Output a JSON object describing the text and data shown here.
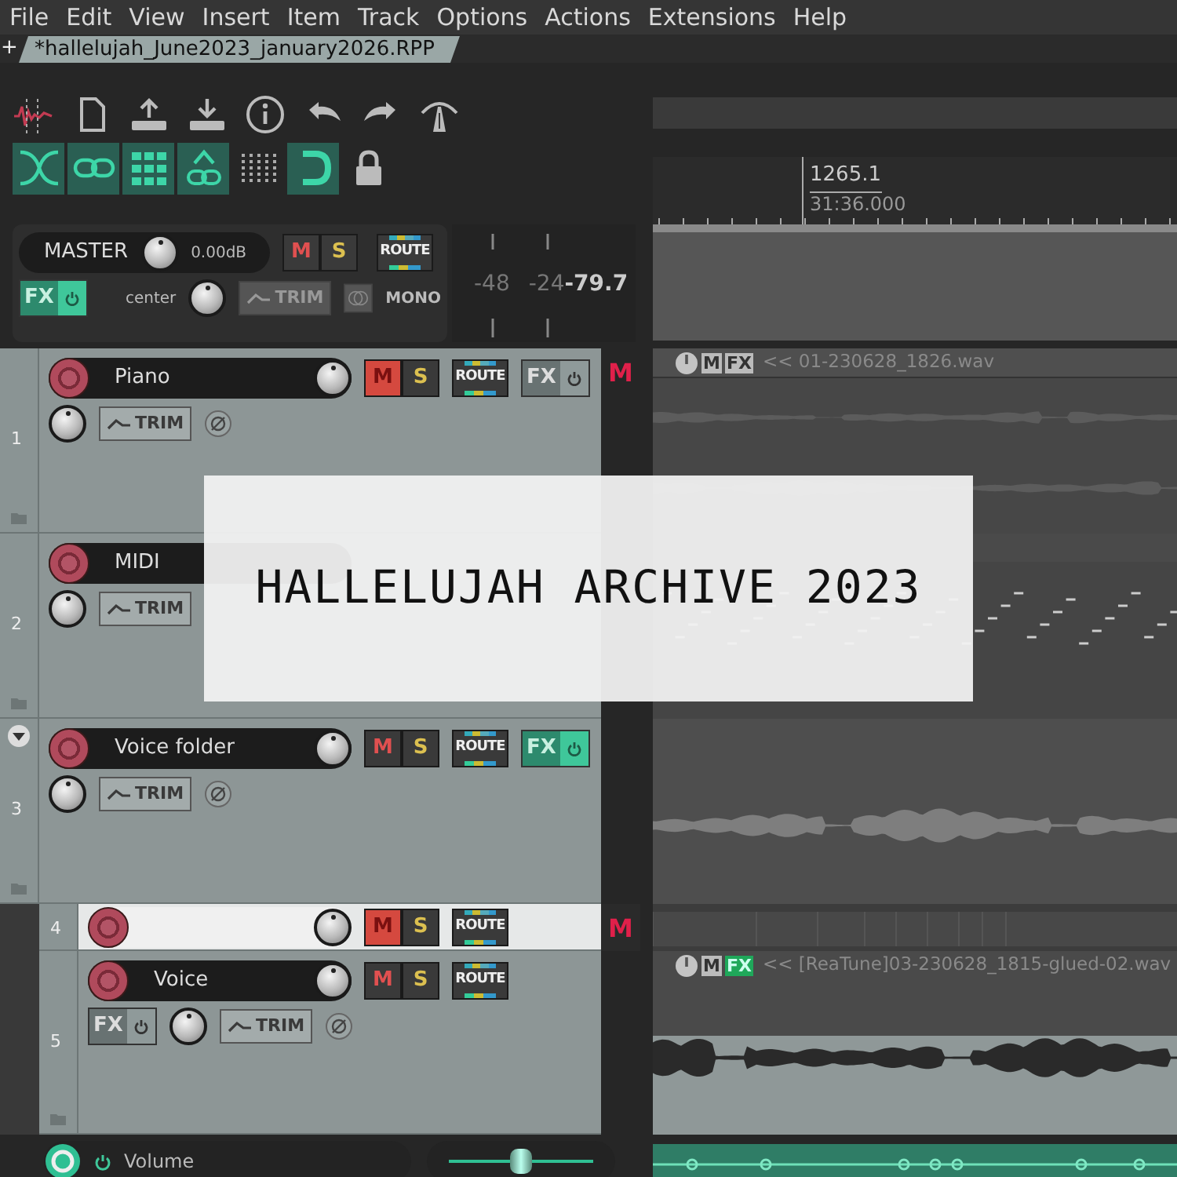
{
  "menu": [
    {
      "label": "File"
    },
    {
      "label": "Edit"
    },
    {
      "label": "View"
    },
    {
      "label": "Insert"
    },
    {
      "label": "Item"
    },
    {
      "label": "Track"
    },
    {
      "label": "Options"
    },
    {
      "label": "Actions"
    },
    {
      "label": "Extensions"
    },
    {
      "label": "Help"
    }
  ],
  "new_tab": "+",
  "tabs": [
    {
      "label": "*hallelujah_June2023_january2026.RPP",
      "selected": true
    }
  ],
  "toolbar_row_1": [
    {
      "kind": "waveform"
    },
    {
      "kind": "document"
    },
    {
      "kind": "upload"
    },
    {
      "kind": "download"
    },
    {
      "kind": "info"
    },
    {
      "kind": "undo"
    },
    {
      "kind": "redo"
    },
    {
      "kind": "road"
    }
  ],
  "toolbar_row_2": [
    {
      "kind": "crossfade",
      "on": true
    },
    {
      "kind": "link",
      "on": true
    },
    {
      "kind": "grid",
      "on": true
    },
    {
      "kind": "linked-nodes",
      "on": true
    },
    {
      "kind": "dots",
      "on": false
    },
    {
      "kind": "magnet",
      "on": true
    },
    {
      "kind": "lock",
      "on": false
    }
  ],
  "ruler": {
    "beat": "1265.1",
    "time": "31:36.000"
  },
  "master": {
    "name": "MASTER",
    "volume": "0.00dB",
    "mute": {
      "label": "M",
      "on": false
    },
    "solo": {
      "label": "S",
      "on": false
    },
    "route": "ROUTE",
    "fx": {
      "label": "FX",
      "on": true
    },
    "pan": "center",
    "trim": "TRIM",
    "mono": "MONO"
  },
  "meter": {
    "ticks": [
      "-48",
      "-24"
    ],
    "peak": "-79.7"
  },
  "tracks": [
    {
      "number": "1",
      "name": "Piano",
      "kind": "full",
      "selected": false,
      "mute": {
        "label": "M",
        "on": true
      },
      "solo": {
        "label": "S",
        "on": false
      },
      "route": "ROUTE",
      "fx": {
        "label": "FX",
        "on": false
      },
      "trim": "TRIM",
      "mute_flag": "M",
      "item": {
        "kind": "audio-dim",
        "mute": "M",
        "fx": {
          "label": "FX",
          "on": false
        },
        "label": "<< 01-230628_1826.wav"
      }
    },
    {
      "number": "2",
      "name": "MIDI",
      "kind": "full",
      "selected": false,
      "trim": "TRIM",
      "item": {
        "kind": "midi"
      }
    },
    {
      "number": "3",
      "name": "Voice folder",
      "kind": "full",
      "selected": false,
      "folder_expanded": true,
      "mute": {
        "label": "M",
        "on": false
      },
      "solo": {
        "label": "S",
        "on": false
      },
      "route": "ROUTE",
      "fx": {
        "label": "FX",
        "on": true
      },
      "trim": "TRIM",
      "item": {
        "kind": "audio"
      },
      "children": [
        {
          "number": "4",
          "kind": "compact",
          "selected": true,
          "mute": {
            "label": "M",
            "on": true
          },
          "solo": {
            "label": "S",
            "on": false
          },
          "route": "ROUTE",
          "mute_flag": "M",
          "item": {
            "kind": "fragments"
          }
        },
        {
          "number": "5",
          "name": "Voice",
          "kind": "full",
          "selected": false,
          "mute": {
            "label": "M",
            "on": false
          },
          "solo": {
            "label": "S",
            "on": false
          },
          "route": "ROUTE",
          "fx": {
            "label": "FX",
            "on": false
          },
          "trim": "TRIM",
          "item": {
            "kind": "audio-bright",
            "mute": "M",
            "fx": {
              "label": "FX",
              "on": true
            },
            "label": "<< [ReaTune]03-230628_1815-glued-02.wav"
          }
        }
      ]
    }
  ],
  "envelope": {
    "name": "Volume",
    "on": true,
    "level": 0.5
  },
  "banner": "HALLELUJAH ARCHIVE 2023"
}
